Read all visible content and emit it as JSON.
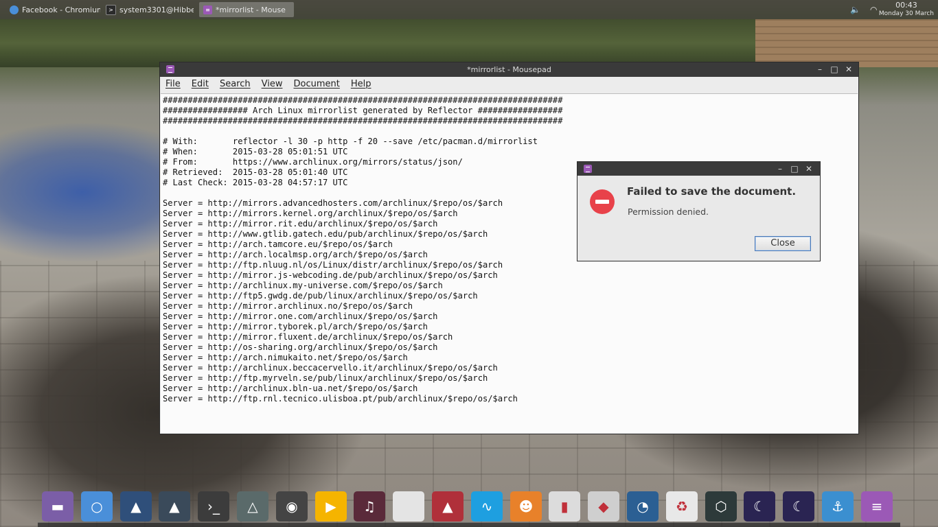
{
  "taskbar": {
    "tasks": [
      {
        "label": "Facebook - Chromium",
        "icon": "chromium-icon",
        "active": false
      },
      {
        "label": "system3301@Hibbe",
        "icon": "terminal-icon",
        "active": false
      },
      {
        "label": "*mirrorlist - Mouse",
        "icon": "mousepad-icon",
        "active": true
      }
    ],
    "clock": {
      "time": "00:43",
      "date": "Monday 30 March"
    }
  },
  "window": {
    "title": "*mirrorlist - Mousepad",
    "menu": [
      "File",
      "Edit",
      "Search",
      "View",
      "Document",
      "Help"
    ],
    "lines": [
      "################################################################################",
      "################# Arch Linux mirrorlist generated by Reflector #################",
      "################################################################################",
      "",
      "# With:       reflector -l 30 -p http -f 20 --save /etc/pacman.d/mirrorlist",
      "# When:       2015-03-28 05:01:51 UTC",
      "# From:       https://www.archlinux.org/mirrors/status/json/",
      "# Retrieved:  2015-03-28 05:01:40 UTC",
      "# Last Check: 2015-03-28 04:57:17 UTC",
      "",
      "Server = http://mirrors.advancedhosters.com/archlinux/$repo/os/$arch",
      "Server = http://mirrors.kernel.org/archlinux/$repo/os/$arch",
      "Server = http://mirror.rit.edu/archlinux/$repo/os/$arch",
      "Server = http://www.gtlib.gatech.edu/pub/archlinux/$repo/os/$arch",
      "Server = http://arch.tamcore.eu/$repo/os/$arch",
      "Server = http://arch.localmsp.org/arch/$repo/os/$arch",
      "Server = http://ftp.nluug.nl/os/Linux/distr/archlinux/$repo/os/$arch",
      "Server = http://mirror.js-webcoding.de/pub/archlinux/$repo/os/$arch",
      "Server = http://archlinux.my-universe.com/$repo/os/$arch",
      "Server = http://ftp5.gwdg.de/pub/linux/archlinux/$repo/os/$arch",
      "Server = http://mirror.archlinux.no/$repo/os/$arch",
      "Server = http://mirror.one.com/archlinux/$repo/os/$arch",
      "Server = http://mirror.tyborek.pl/arch/$repo/os/$arch",
      "Server = http://mirror.fluxent.de/archlinux/$repo/os/$arch",
      "Server = http://os-sharing.org/archlinux/$repo/os/$arch",
      "Server = http://arch.nimukaito.net/$repo/os/$arch",
      "Server = http://archlinux.beccacervello.it/archlinux/$repo/os/$arch",
      "Server = http://ftp.myrveln.se/pub/linux/archlinux/$repo/os/$arch",
      "Server = http://archlinux.bln-ua.net/$repo/os/$arch",
      "Server = http://ftp.rnl.tecnico.ulisboa.pt/pub/archlinux/$repo/os/$arch"
    ]
  },
  "dialog": {
    "heading": "Failed to save the document.",
    "message": "Permission denied.",
    "close_label": "Close",
    "icon": "error-icon"
  },
  "dock": {
    "items": [
      {
        "name": "files-icon",
        "color": "#7b5ea7",
        "glyph": "▬"
      },
      {
        "name": "chromium-icon",
        "color": "#4a8fd9",
        "glyph": "○"
      },
      {
        "name": "image-viewer-icon",
        "color": "#2f4f7a",
        "glyph": "▲"
      },
      {
        "name": "arch-icon",
        "color": "#3a4a5a",
        "glyph": "▲"
      },
      {
        "name": "terminal-icon",
        "color": "#3c3c3c",
        "glyph": "›_"
      },
      {
        "name": "drive-icon",
        "color": "#5a6a6a",
        "glyph": "△"
      },
      {
        "name": "webcam-icon",
        "color": "#444444",
        "glyph": "◉"
      },
      {
        "name": "media-player-icon",
        "color": "#f5b400",
        "glyph": "▶"
      },
      {
        "name": "headphones-icon",
        "color": "#5a2a3a",
        "glyph": "♫"
      },
      {
        "name": "document-icon",
        "color": "#e4e4e4",
        "glyph": ""
      },
      {
        "name": "red-app-icon",
        "color": "#b0303a",
        "glyph": "▲"
      },
      {
        "name": "system-monitor-icon",
        "color": "#1e9fe0",
        "glyph": "∿"
      },
      {
        "name": "gimp-icon",
        "color": "#e8812a",
        "glyph": "☻"
      },
      {
        "name": "video-editor-icon",
        "color": "#dcdcdc",
        "glyph": "▮"
      },
      {
        "name": "room-designer-icon",
        "color": "#cfcfcf",
        "glyph": "◆"
      },
      {
        "name": "blender-icon",
        "color": "#2b5f93",
        "glyph": "◔"
      },
      {
        "name": "recycle-icon",
        "color": "#e8e8e8",
        "glyph": "♻"
      },
      {
        "name": "cube-icon",
        "color": "#2d3a3a",
        "glyph": "⬡"
      },
      {
        "name": "night-mode-icon",
        "color": "#2a2452",
        "glyph": "☾"
      },
      {
        "name": "night-mode-2-icon",
        "color": "#2a2452",
        "glyph": "☾"
      },
      {
        "name": "anchor-icon",
        "color": "#3b8fd0",
        "glyph": "⚓"
      },
      {
        "name": "text-editor-icon",
        "color": "#9b59b6",
        "glyph": "≡"
      }
    ]
  }
}
